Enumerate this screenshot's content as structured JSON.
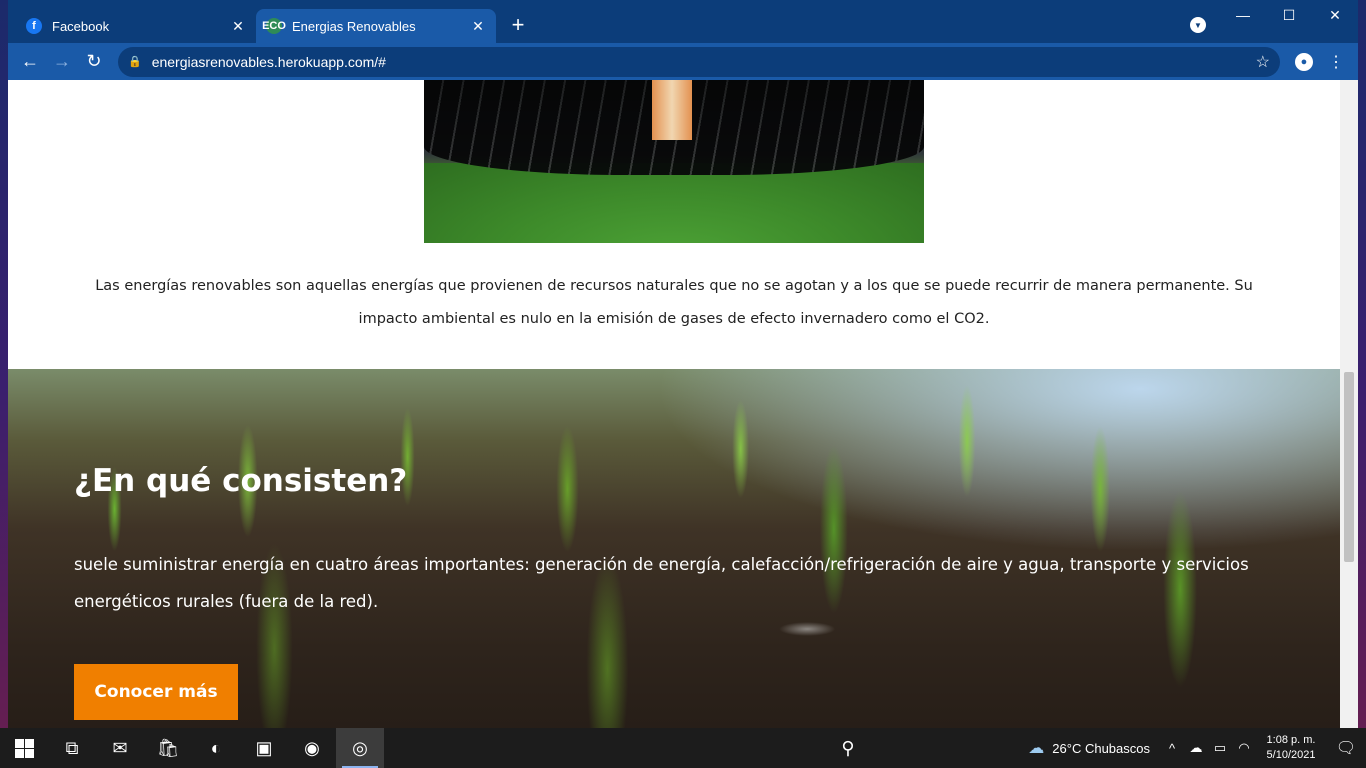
{
  "tabs": [
    {
      "title": "Facebook",
      "icon": "facebook-icon",
      "active": false
    },
    {
      "title": "Energias Renovables",
      "icon": "eco-leaf-icon",
      "active": true
    }
  ],
  "toolbar": {
    "url": "energiasrenovables.herokuapp.com/#"
  },
  "page": {
    "intro_text": "Las energías renovables son aquellas energías que provienen de recursos naturales que no se agotan y a los que se puede recurrir de manera permanente. Su impacto ambiental es nulo en la emisión de gases de efecto invernadero como el CO2.",
    "hero": {
      "title": "¿En qué consisten?",
      "text": "suele suministrar energía en cuatro áreas importantes: generación de energía, calefacción/refrigeración de aire y agua, transporte y servicios energéticos rurales (fuera de la red).",
      "button_label": "Conocer más",
      "button_color": "#f07f00"
    }
  },
  "taskbar": {
    "weather": "26°C  Chubascos",
    "time": "1:08 p. m.",
    "date": "5/10/2021"
  },
  "colors": {
    "tabstrip": "#0c3d7a",
    "toolbar": "#1a5aa8"
  }
}
